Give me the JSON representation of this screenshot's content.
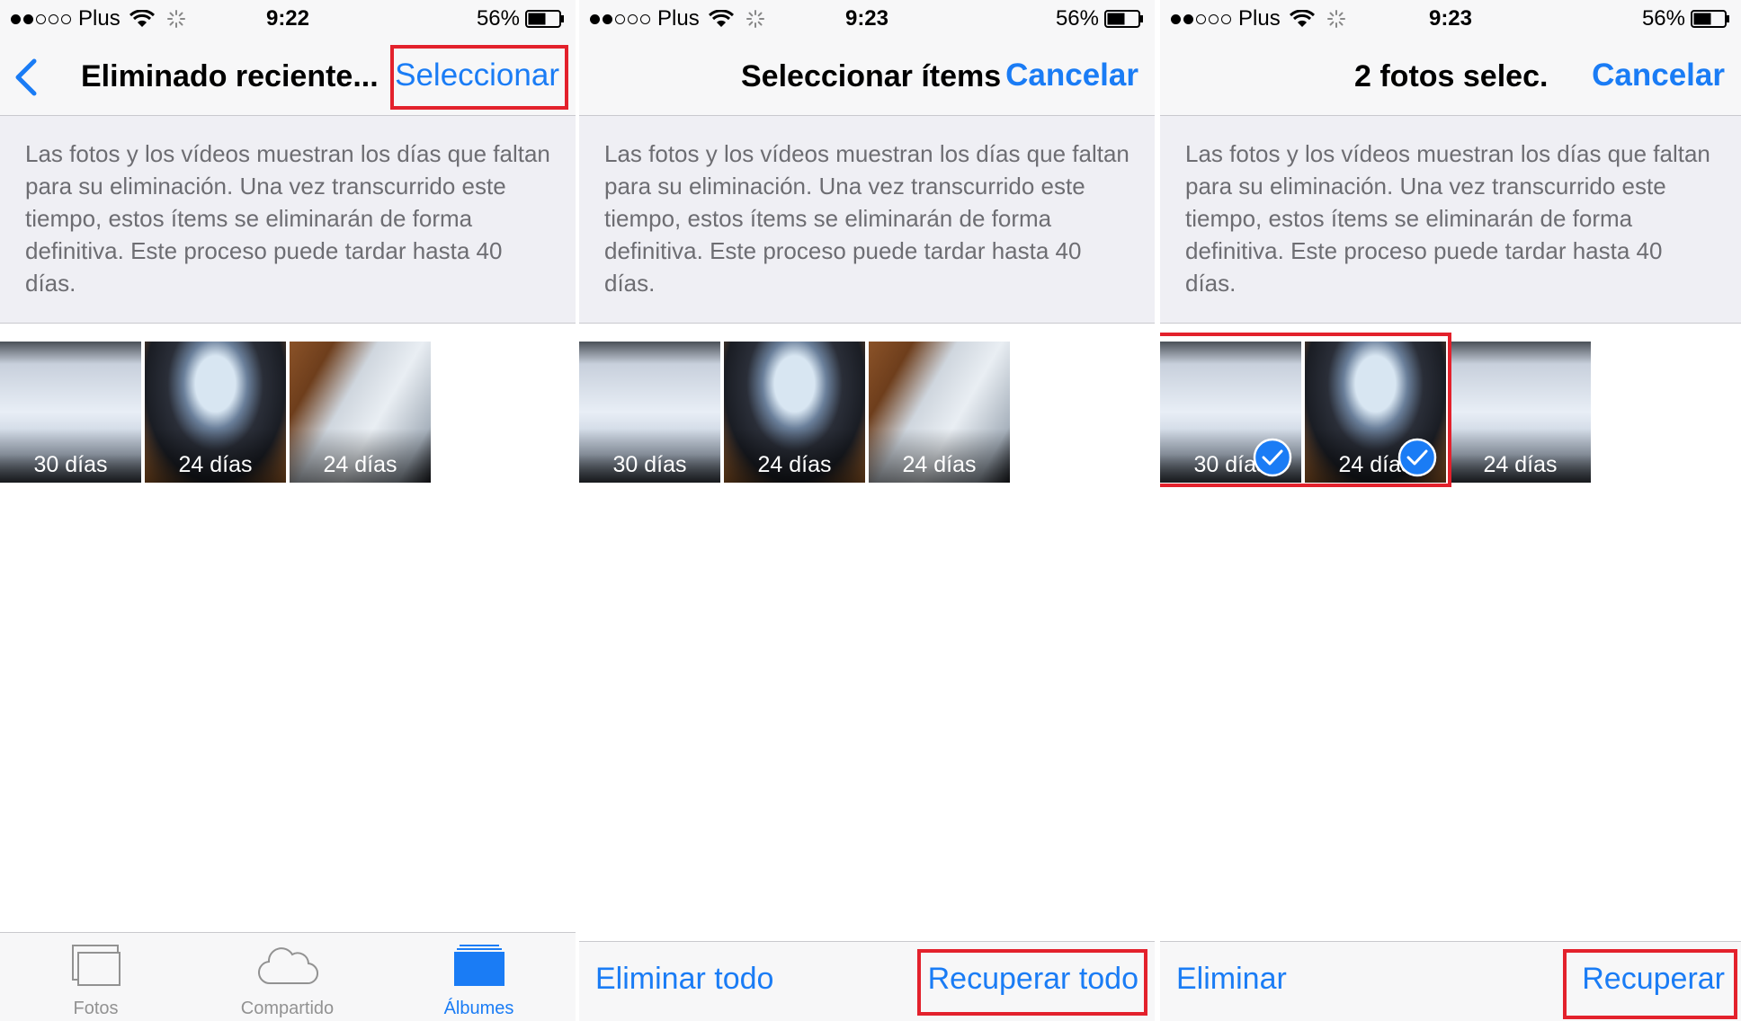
{
  "status": {
    "carrier": "Plus",
    "battery": "56%",
    "times": [
      "9:22",
      "9:23",
      "9:23"
    ]
  },
  "screen1": {
    "title": "Eliminado reciente...",
    "select": "Seleccionar",
    "info": "Las fotos y los vídeos muestran los días que faltan para su eliminación. Una vez transcurrido este tiempo, estos ítems se eliminarán de forma definitiva. Este proceso puede tardar hasta 40 días.",
    "thumbs": [
      "30 días",
      "24 días",
      "24 días"
    ],
    "tabs": [
      "Fotos",
      "Compartido",
      "Álbumes"
    ]
  },
  "screen2": {
    "title": "Seleccionar ítems",
    "cancel": "Cancelar",
    "info": "Las fotos y los vídeos muestran los días que faltan para su eliminación. Una vez transcurrido este tiempo, estos ítems se eliminarán de forma definitiva. Este proceso puede tardar hasta 40 días.",
    "thumbs": [
      "30 días",
      "24 días",
      "24 días"
    ],
    "delete_all": "Eliminar todo",
    "recover_all": "Recuperar todo"
  },
  "screen3": {
    "title": "2 fotos selec.",
    "cancel": "Cancelar",
    "info": "Las fotos y los vídeos muestran los días que faltan para su eliminación. Una vez transcurrido este tiempo, estos ítems se eliminarán de forma definitiva. Este proceso puede tardar hasta 40 días.",
    "thumbs": [
      "30 días",
      "24 días",
      "24 días"
    ],
    "delete": "Eliminar",
    "recover": "Recuperar"
  },
  "colors": {
    "accent": "#1a7cf5",
    "highlight": "#e3212c",
    "bar": "#f7f7f8",
    "info_bg": "#efeff4"
  }
}
